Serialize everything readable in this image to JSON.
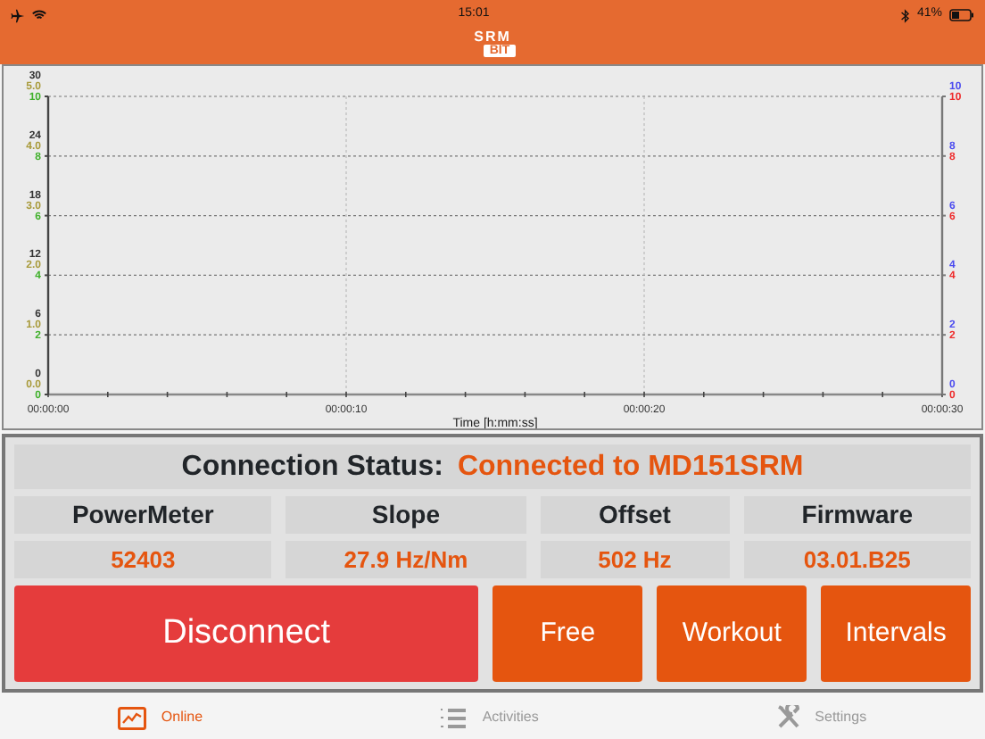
{
  "status_bar": {
    "time": "15:01",
    "battery": "41%"
  },
  "app_bar": {
    "logo_top": "SRM",
    "logo_bottom": "BIT"
  },
  "chart": {
    "chart_data": {
      "type": "line",
      "xlabel": "Time [h:mm:ss]",
      "xlim": [
        0,
        30
      ],
      "ylim": [
        0,
        10
      ],
      "xticks": [
        {
          "value": 0,
          "label": "00:00:00"
        },
        {
          "value": 10,
          "label": "00:00:10"
        },
        {
          "value": 20,
          "label": "00:00:20"
        },
        {
          "value": 30,
          "label": "00:00:30"
        }
      ],
      "yticks": [
        0,
        2,
        4,
        6,
        8,
        10
      ],
      "grid": true
    },
    "left_axes": [
      {
        "color": "#333333",
        "labels": [
          "30",
          "24",
          "18",
          "12",
          "6",
          "0"
        ]
      },
      {
        "color": "#a89a3a",
        "labels": [
          "5.0",
          "4.0",
          "3.0",
          "2.0",
          "1.0",
          "0.0"
        ]
      },
      {
        "color": "#3fb02a",
        "labels": [
          "10",
          "8",
          "6",
          "4",
          "2",
          "0"
        ]
      }
    ],
    "right_axes": [
      {
        "color": "#4a4aef",
        "labels": [
          "10",
          "8",
          "6",
          "4",
          "2",
          "0"
        ]
      },
      {
        "color": "#ee2a2a",
        "labels": [
          "10",
          "8",
          "6",
          "4",
          "2",
          "0"
        ]
      }
    ]
  },
  "connection": {
    "label": "Connection Status:",
    "value": "Connected to MD151SRM"
  },
  "readings": [
    {
      "label": "PowerMeter",
      "value": "52403"
    },
    {
      "label": "Slope",
      "value": "27.9 Hz/Nm"
    },
    {
      "label": "Offset",
      "value": "502 Hz"
    },
    {
      "label": "Firmware",
      "value": "03.01.B25"
    }
  ],
  "buttons": [
    {
      "label": "Disconnect",
      "kind": "danger"
    },
    {
      "label": "Free",
      "kind": "mode"
    },
    {
      "label": "Workout",
      "kind": "mode"
    },
    {
      "label": "Intervals",
      "kind": "mode"
    }
  ],
  "tabs": [
    {
      "label": "Online",
      "selected": true
    },
    {
      "label": "Activities",
      "selected": false
    },
    {
      "label": "Settings",
      "selected": false
    }
  ]
}
